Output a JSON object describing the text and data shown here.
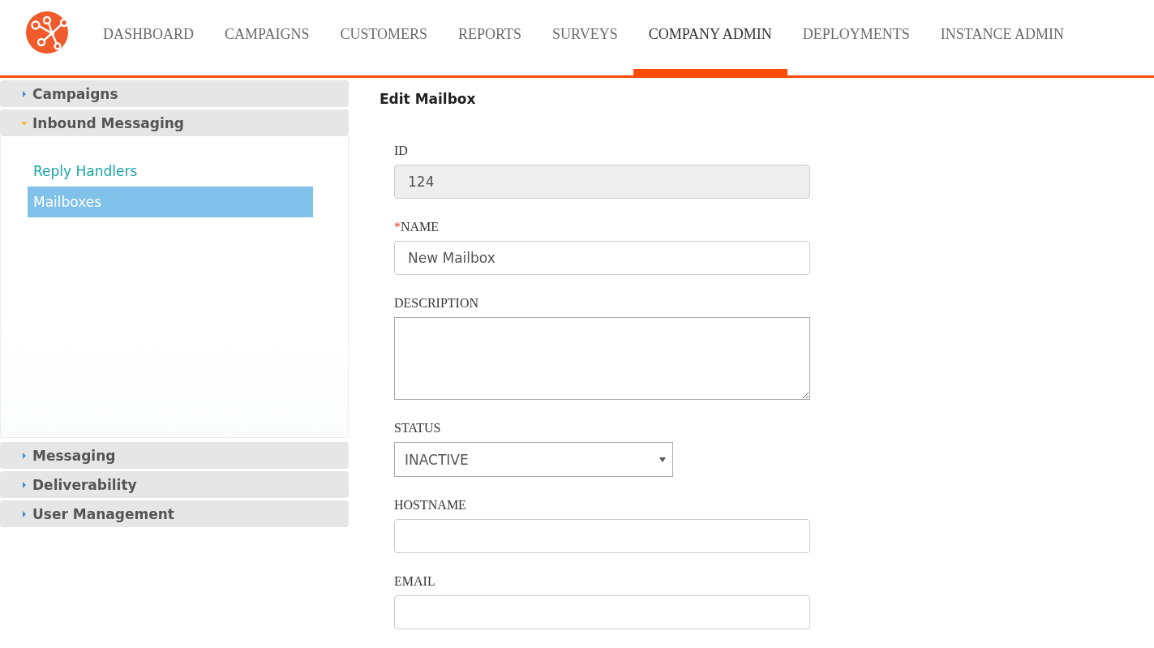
{
  "nav": {
    "tabs": [
      {
        "label": "DASHBOARD",
        "selected": false
      },
      {
        "label": "CAMPAIGNS",
        "selected": false
      },
      {
        "label": "CUSTOMERS",
        "selected": false
      },
      {
        "label": "REPORTS",
        "selected": false
      },
      {
        "label": "SURVEYS",
        "selected": false
      },
      {
        "label": "COMPANY ADMIN",
        "selected": true
      },
      {
        "label": "DEPLOYMENTS",
        "selected": false
      },
      {
        "label": "INSTANCE ADMIN",
        "selected": false
      }
    ]
  },
  "sidebar": {
    "sections": [
      {
        "label": "Campaigns",
        "expanded": false
      },
      {
        "label": "Inbound Messaging",
        "expanded": true,
        "children": [
          {
            "label": "Reply Handlers",
            "selected": false
          },
          {
            "label": "Mailboxes",
            "selected": true
          }
        ]
      },
      {
        "label": "Messaging",
        "expanded": false
      },
      {
        "label": "Deliverability",
        "expanded": false
      },
      {
        "label": "User Management",
        "expanded": false
      }
    ]
  },
  "form": {
    "title": "Edit Mailbox",
    "fields": [
      {
        "kind": "text",
        "label": "ID",
        "value": "124",
        "disabled": true
      },
      {
        "kind": "text",
        "label": "NAME",
        "required_mark": "*",
        "value": "New Mailbox",
        "disabled": false
      },
      {
        "kind": "textarea",
        "label": "DESCRIPTION",
        "disabled": false
      },
      {
        "kind": "select",
        "label": "STATUS",
        "value": "INACTIVE",
        "disabled": false
      },
      {
        "kind": "text",
        "label": "HOSTNAME",
        "disabled": false
      },
      {
        "kind": "text",
        "label": "EMAIL",
        "disabled": false
      }
    ]
  }
}
